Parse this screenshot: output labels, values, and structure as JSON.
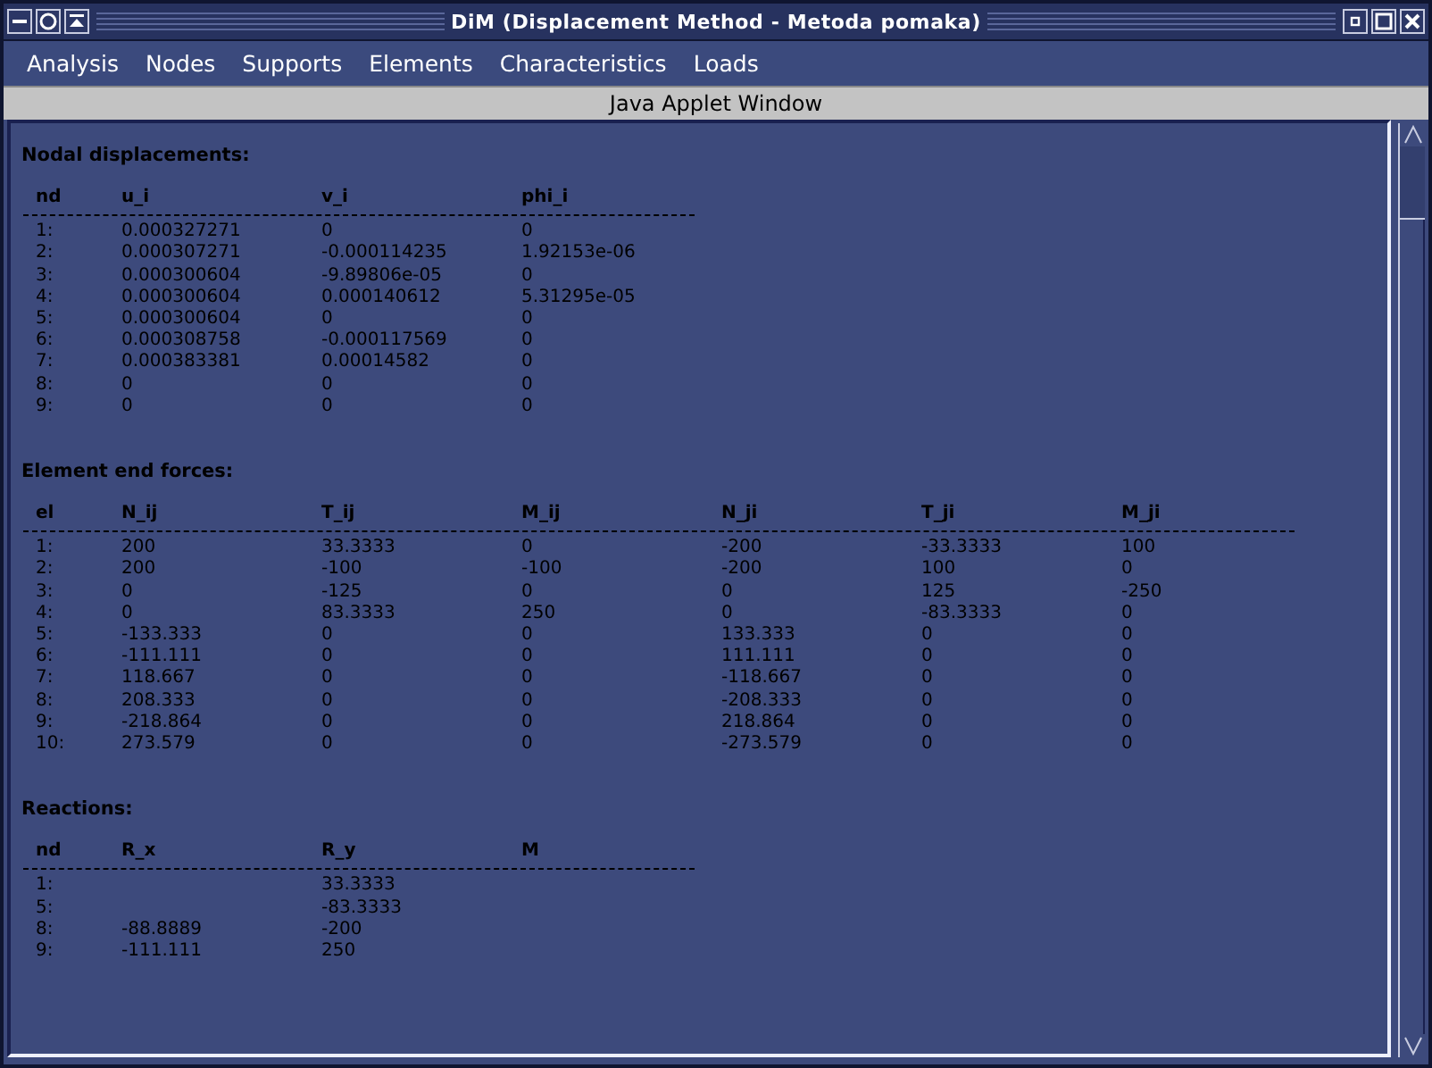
{
  "window": {
    "title": "DiM (Displacement Method - Metoda pomaka)"
  },
  "menu": [
    "Analysis",
    "Nodes",
    "Supports",
    "Elements",
    "Characteristics",
    "Loads"
  ],
  "applet_banner": "Java Applet Window",
  "sections": [
    {
      "title": "Nodal displacements:",
      "columns": [
        "nd",
        "u_i",
        "v_i",
        "phi_i"
      ],
      "rows": [
        [
          "1:",
          "0.000327271",
          "0",
          "0"
        ],
        [
          "2:",
          "0.000307271",
          "-0.000114235",
          "1.92153e-06"
        ],
        [
          "3:",
          "0.000300604",
          "-9.89806e-05",
          "0"
        ],
        [
          "4:",
          "0.000300604",
          "0.000140612",
          "5.31295e-05"
        ],
        [
          "5:",
          "0.000300604",
          "0",
          "0"
        ],
        [
          "6:",
          "0.000308758",
          "-0.000117569",
          "0"
        ],
        [
          "7:",
          "0.000383381",
          "0.00014582",
          "0"
        ],
        [
          "8:",
          "0",
          "0",
          "0"
        ],
        [
          "9:",
          "0",
          "0",
          "0"
        ]
      ]
    },
    {
      "title": "Element end forces:",
      "columns": [
        "el",
        "N_ij",
        "T_ij",
        "M_ij",
        "N_ji",
        "T_ji",
        "M_ji"
      ],
      "rows": [
        [
          "1:",
          "200",
          "33.3333",
          "0",
          "-200",
          "-33.3333",
          "100"
        ],
        [
          "2:",
          "200",
          "-100",
          "-100",
          "-200",
          "100",
          "0"
        ],
        [
          "3:",
          "0",
          "-125",
          "0",
          "0",
          "125",
          "-250"
        ],
        [
          "4:",
          "0",
          "83.3333",
          "250",
          "0",
          "-83.3333",
          "0"
        ],
        [
          "5:",
          "-133.333",
          "0",
          "0",
          "133.333",
          "0",
          "0"
        ],
        [
          "6:",
          "-111.111",
          "0",
          "0",
          "111.111",
          "0",
          "0"
        ],
        [
          "7:",
          "118.667",
          "0",
          "0",
          "-118.667",
          "0",
          "0"
        ],
        [
          "8:",
          "208.333",
          "0",
          "0",
          "-208.333",
          "0",
          "0"
        ],
        [
          "9:",
          "-218.864",
          "0",
          "0",
          "218.864",
          "0",
          "0"
        ],
        [
          "10:",
          "273.579",
          "0",
          "0",
          "-273.579",
          "0",
          "0"
        ]
      ]
    },
    {
      "title": "Reactions:",
      "columns": [
        "nd",
        "R_x",
        "R_y",
        "M"
      ],
      "rows": [
        [
          "1:",
          null,
          "33.3333"
        ],
        [
          "5:",
          null,
          "-83.3333"
        ],
        [
          "8:",
          "-88.8889",
          "-200"
        ],
        [
          "9:",
          "-111.111",
          "250"
        ]
      ]
    }
  ]
}
